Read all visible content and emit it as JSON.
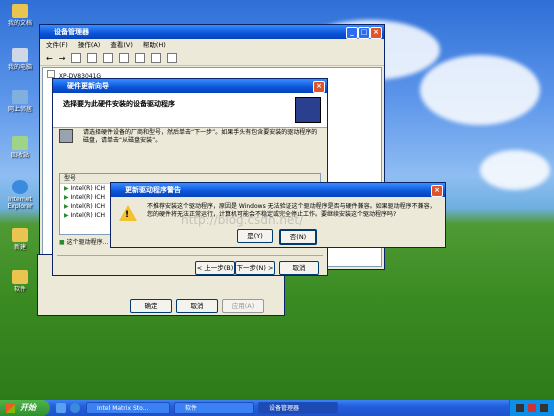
{
  "desktop": {
    "icons": [
      {
        "label": "我的文档",
        "color": "#e9c44f"
      },
      {
        "label": "我的电脑",
        "color": "#cfd8e6"
      },
      {
        "label": "网上邻居",
        "color": "#7fb0e0"
      },
      {
        "label": "回收站",
        "color": "#9fd38a"
      },
      {
        "label": "Internet Explorer",
        "color": "#3a8be0"
      },
      {
        "label": "新建",
        "color": "#e9c44f"
      },
      {
        "label": "软件",
        "color": "#e9c44f"
      }
    ]
  },
  "device_manager": {
    "title": "设备管理器",
    "menu": [
      "文件(F)",
      "操作(A)",
      "查看(V)",
      "帮助(H)"
    ],
    "tree_root": "XP-DV83041G"
  },
  "wizard": {
    "title": "硬件更新向导",
    "heading": "选择要为此硬件安装的设备驱动程序",
    "instruction": "请选择硬件设备的厂商和型号，然后单击“下一步”。如果手头有包含要安装的驱动程序的磁盘，请单击“从磁盘安装”。",
    "list_header": "型号",
    "list_items": [
      "Intel(R) ICH",
      "Intel(R) ICH",
      "Intel(R) ICH",
      "Intel(R) ICH"
    ],
    "signed_note": "这个驱动程序...",
    "back_label": "< 上一步(B)",
    "next_label": "下一步(N) >",
    "cancel_label": "取消"
  },
  "props": {
    "ok_label": "确定",
    "cancel_label": "取消",
    "apply_label": "应用(A)"
  },
  "warning": {
    "title": "更新驱动程序警告",
    "message_line1": "不推荐安装这个驱动程序，原因是 Windows 无法验证这个驱动程序是否与硬件兼容。如果驱动程序不兼容，",
    "message_line2": "您的硬件将无法正常运行，计算机可能会不稳定或完全停止工作。要继续安装这个驱动程序吗?",
    "yes_label": "是(Y)",
    "no_label": "否(N)",
    "watermark": "http://blog.csdn.net/"
  },
  "taskbar": {
    "start_label": "开始",
    "items": [
      "Intel Matrix Sto...",
      "软件",
      "设备管理器"
    ]
  },
  "colors": {
    "xp_blue": "#0a54d8",
    "taskbar_blue": "#245edc",
    "start_green": "#3c9c34"
  }
}
